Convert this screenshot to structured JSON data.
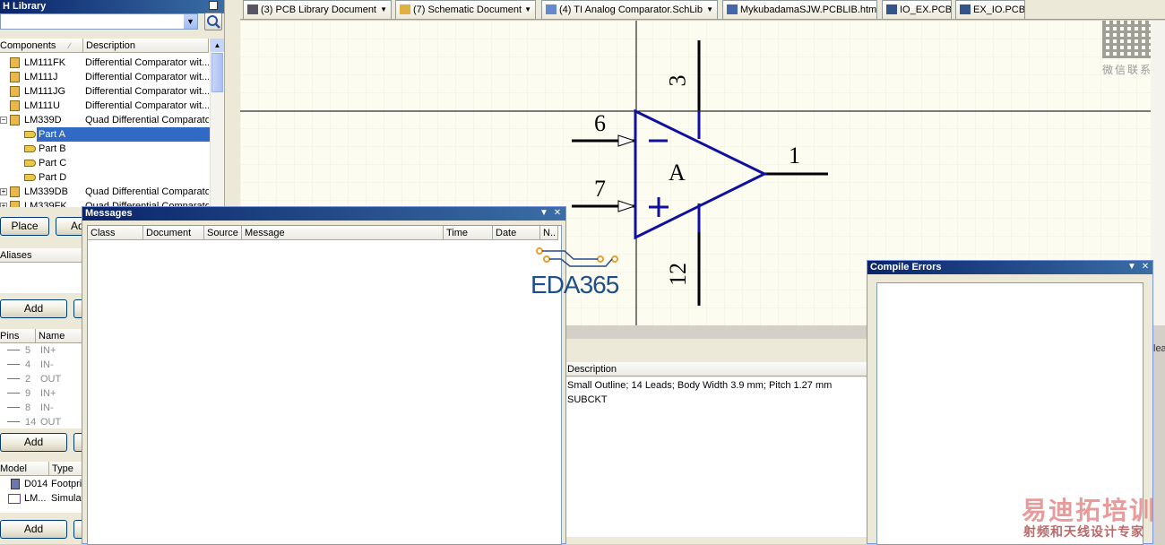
{
  "library_panel": {
    "title": "H Library",
    "columns": {
      "components": "Components",
      "description": "Description"
    },
    "components": [
      {
        "name": "LM111FK",
        "description": "Differential Comparator wit..."
      },
      {
        "name": "LM111J",
        "description": "Differential Comparator wit..."
      },
      {
        "name": "LM111JG",
        "description": "Differential Comparator wit..."
      },
      {
        "name": "LM111U",
        "description": "Differential Comparator wit..."
      },
      {
        "name": "LM339D",
        "description": "Quad Differential Comparator"
      },
      {
        "name": "Part A",
        "description": ""
      },
      {
        "name": "Part B",
        "description": ""
      },
      {
        "name": "Part C",
        "description": ""
      },
      {
        "name": "Part D",
        "description": ""
      },
      {
        "name": "LM339DB",
        "description": "Quad Differential Comparator"
      },
      {
        "name": "LM339FK",
        "description": "Quad Differential Comparator"
      }
    ],
    "place_label": "Place",
    "add_label_partial": "Ad",
    "aliases_label": "Aliases",
    "add_label": "Add",
    "pins_columns": {
      "pins": "Pins",
      "name": "Name"
    },
    "pins": [
      {
        "pin": "5",
        "name": "IN+"
      },
      {
        "pin": "4",
        "name": "IN-"
      },
      {
        "pin": "2",
        "name": "OUT"
      },
      {
        "pin": "9",
        "name": "IN+"
      },
      {
        "pin": "8",
        "name": "IN-"
      },
      {
        "pin": "14",
        "name": "OUT"
      }
    ],
    "model_columns": {
      "model": "Model",
      "type": "Type"
    },
    "models": [
      {
        "model": "D014",
        "type": "Footpri"
      },
      {
        "model": "LM...",
        "type": "Simulat"
      }
    ]
  },
  "tabs": [
    {
      "label": "(3) PCB Library Document",
      "icon": "pcb-library-icon"
    },
    {
      "label": "(7) Schematic Document",
      "icon": "schematic-icon"
    },
    {
      "label": "(4) TI Analog Comparator.SchLib",
      "icon": "schlib-icon"
    },
    {
      "label": "MykubadamaSJW.PCBLIB.htm",
      "icon": "html-doc-icon"
    },
    {
      "label": "IO_EX.PCB",
      "icon": "pcb-icon"
    },
    {
      "label": "EX_IO.PCB",
      "icon": "pcb-icon"
    }
  ],
  "schematic": {
    "part_label": "A",
    "pins": {
      "top": "3",
      "inv_input": "6",
      "noninv_input": "7",
      "output": "1",
      "bottom": "12"
    },
    "minus_symbol": "−",
    "plus_symbol": "+",
    "colors": {
      "body": "#1010a0",
      "wire": "#000000",
      "sheet": "#fcfcf0"
    }
  },
  "messages_panel": {
    "title": "Messages",
    "columns": [
      "Class",
      "Document",
      "Source",
      "Message",
      "Time",
      "Date",
      "N.."
    ]
  },
  "description_panel": {
    "header": "Description",
    "lines": [
      "Small Outline; 14 Leads; Body Width 3.9 mm; Pitch 1.27 mm",
      "SUBCKT"
    ]
  },
  "compile_errors_panel": {
    "title": "Compile Errors"
  },
  "right_edge_text": "lea",
  "watermarks": {
    "qr_caption": "微信联系",
    "eda365": "EDA365",
    "brand_title": "易迪拓培训",
    "brand_subtitle": "射频和天线设计专家"
  }
}
